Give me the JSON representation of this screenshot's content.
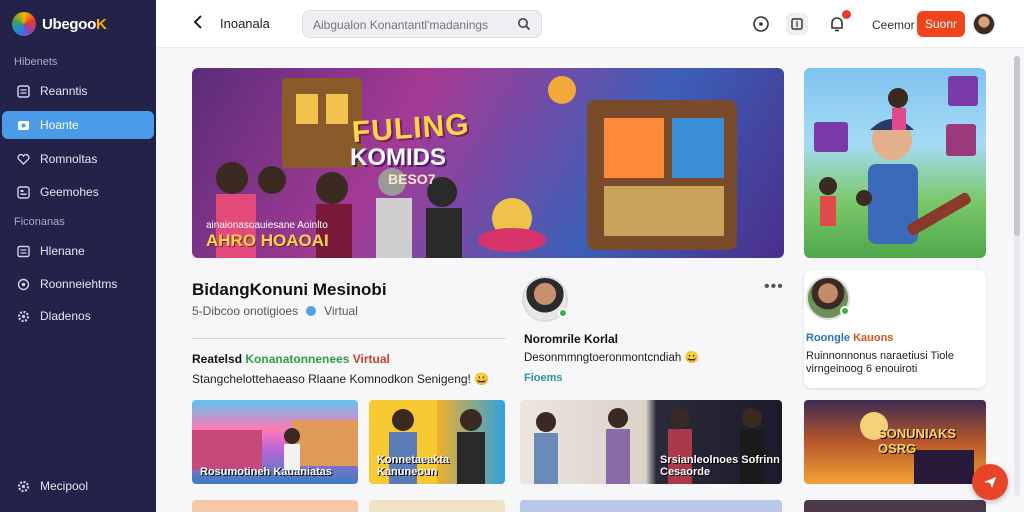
{
  "app": {
    "name_part1": "Ubegoo",
    "name_part2": "K"
  },
  "sidebar": {
    "section1": "Hibenets",
    "section2": "Ficonanas",
    "items": [
      {
        "label": "Reanntis",
        "icon": "list-icon"
      },
      {
        "label": "Hoante",
        "icon": "users-icon"
      },
      {
        "label": "Romnoltas",
        "icon": "heart-icon"
      },
      {
        "label": "Geemohes",
        "icon": "grid-icon"
      },
      {
        "label": "Hlenane",
        "icon": "document-icon"
      },
      {
        "label": "Roonneiehtms",
        "icon": "settings-icon"
      },
      {
        "label": "Dladenos",
        "icon": "gear-icon"
      }
    ],
    "footer_label": "Mecipool"
  },
  "topbar": {
    "title": "Inoanala",
    "search_placeholder": "Aibgualon Konantantl'madanings",
    "user_name": "Ceemor",
    "submit_label": "Suonr"
  },
  "hero": {
    "title_line1": "FULING",
    "title_line2": "KOMIDS",
    "title_line3": "BESO7",
    "caption_small": "ainaionasoauiesane Aoinlto",
    "caption": "AHRO HOAOAI"
  },
  "post": {
    "title": "BidangKonuni Mesinobi",
    "meta": "5-Dibcoo onotigioes",
    "meta_tag": "Virtual",
    "section_head_a": "Reatelsd",
    "section_head_b": "Konanatonnenees",
    "section_head_c": "Virtual",
    "section_desc": "Stangchelottehaeaso Rlaane Komnodkon Senigeng! 😀"
  },
  "mid_card": {
    "name": "Noromrile Korlal",
    "desc": "Desonmmngtoeronmontcndiah 😀",
    "link": "Fioems"
  },
  "right_card": {
    "name_a": "Roongle",
    "name_b": "Kauons",
    "desc": "Ruinnonnonus naraetiusi Tiole virngeinoog 6 enouiroti"
  },
  "thumbs": [
    {
      "caption": "Rosumotineh Kauaniatas"
    },
    {
      "caption": "Konnetaeakta Kanuneoun"
    },
    {
      "caption": "Srsianleolnoes Sofrinn Cesaorde"
    },
    {
      "caption": "SONUNIAKS OSRG"
    }
  ]
}
